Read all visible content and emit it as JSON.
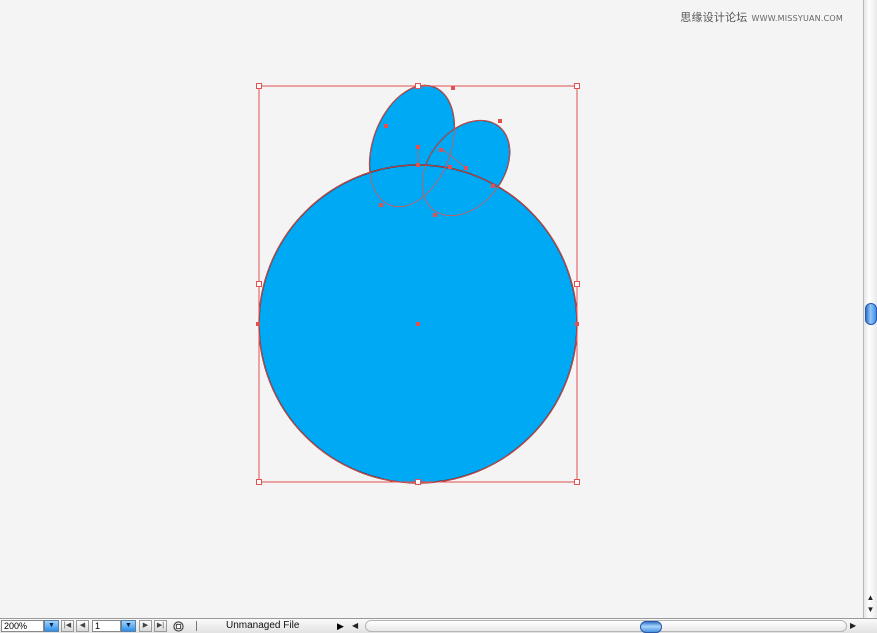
{
  "watermark": {
    "text": "思缘设计论坛",
    "url": "WWW.MISSYUAN.COM"
  },
  "artwork": {
    "fill_color": "#00a9f4",
    "selection_color": "#e25050",
    "outline_color": "#4a1a1a"
  },
  "statusbar": {
    "zoom": "200%",
    "page": "1",
    "status_label": "Unmanaged File"
  },
  "icons": {
    "zoom_dropdown": "chevron-down-icon",
    "first_page": "first-page-icon",
    "prev_page": "prev-page-icon",
    "next_page": "next-page-icon",
    "last_page": "last-page-icon",
    "status": "status-icon",
    "status_menu": "triangle-right-icon"
  }
}
